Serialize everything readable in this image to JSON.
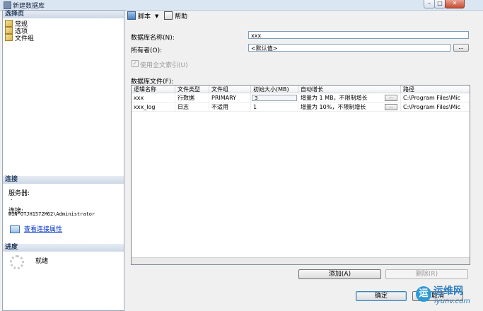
{
  "window": {
    "title": "新建数据库",
    "min_label": "–",
    "max_label": "□",
    "close_label": "✕"
  },
  "left": {
    "select_page_header": "选择页",
    "pages": [
      {
        "label": "常规"
      },
      {
        "label": "选项"
      },
      {
        "label": "文件组"
      }
    ],
    "connection_header": "连接",
    "server_label": "服务器:",
    "server_value": ".",
    "connection_label": "连接:",
    "connection_value": "WIN-OTJH1572M62\\Administrator",
    "view_props_link": "查看连接属性",
    "progress_header": "进度",
    "progress_status": "就绪"
  },
  "toolbar": {
    "script_label": "脚本",
    "dropdown_arrow": "▼",
    "help_label": "帮助"
  },
  "form": {
    "db_name_label": "数据库名称(N):",
    "db_name_value": "xxx",
    "owner_label": "所有者(O):",
    "owner_value": "<默认值>",
    "browse_label": "...",
    "fulltext_label": "使用全文索引(U)",
    "fulltext_checked": true,
    "checkmark": "✓",
    "files_label": "数据库文件(F):"
  },
  "grid": {
    "headers": [
      "逻辑名称",
      "文件类型",
      "文件组",
      "初始大小(MB)",
      "自动增长",
      "路径"
    ],
    "rows": [
      {
        "name": "xxx",
        "type": "行数据",
        "group": "PRIMARY",
        "size": "3",
        "growth": "增量为 1 MB，不限制增长",
        "path": "C:\\Program Files\\Mic"
      },
      {
        "name": "xxx_log",
        "type": "日志",
        "group": "不适用",
        "size": "1",
        "growth": "增量为 10%，不限制增长",
        "path": "C:\\Program Files\\Mic"
      }
    ]
  },
  "buttons": {
    "add": "添加(A)",
    "remove": "删除(R)",
    "ok": "确定",
    "cancel": "取消"
  },
  "watermark": {
    "logo_char": "运",
    "text": "运维网",
    "sub": "iyunv.com"
  },
  "colors": {
    "title_bar": "#dbe6f3",
    "section_header": "#cdd8e6",
    "link": "#0033cc"
  }
}
